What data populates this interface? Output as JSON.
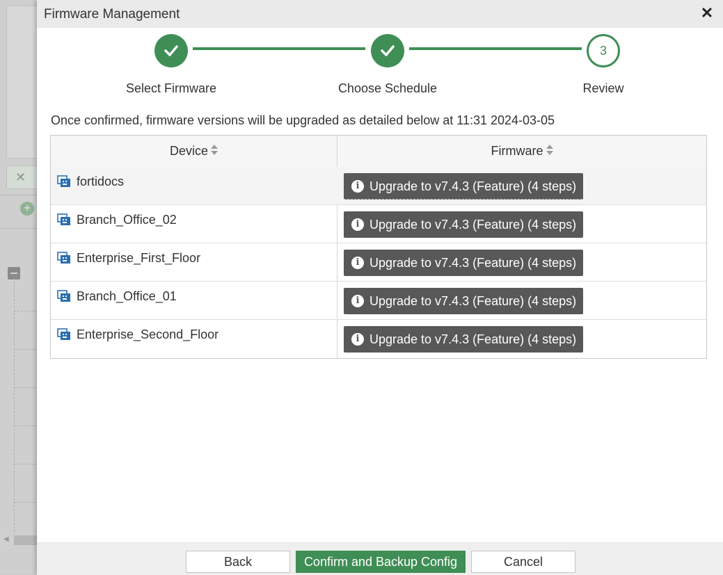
{
  "dialog": {
    "title": "Firmware Management",
    "close_icon": "close-icon"
  },
  "steps": [
    {
      "label": "Select Firmware",
      "state": "done"
    },
    {
      "label": "Choose Schedule",
      "state": "done"
    },
    {
      "label": "Review",
      "state": "current",
      "number": "3"
    }
  ],
  "info_text": "Once confirmed, firmware versions will be upgraded as detailed below at 11:31 2024-03-05",
  "table": {
    "columns": [
      "Device",
      "Firmware"
    ],
    "rows": [
      {
        "device": "fortidocs",
        "firmware": "Upgrade to v7.4.3 (Feature) (4 steps)"
      },
      {
        "device": "Branch_Office_02",
        "firmware": "Upgrade to v7.4.3 (Feature) (4 steps)"
      },
      {
        "device": "Enterprise_First_Floor",
        "firmware": "Upgrade to v7.4.3 (Feature) (4 steps)"
      },
      {
        "device": "Branch_Office_01",
        "firmware": "Upgrade to v7.4.3 (Feature) (4 steps)"
      },
      {
        "device": "Enterprise_Second_Floor",
        "firmware": "Upgrade to v7.4.3 (Feature) (4 steps)"
      }
    ]
  },
  "footer": {
    "back_label": "Back",
    "confirm_label": "Confirm and Backup Config",
    "cancel_label": "Cancel"
  },
  "colors": {
    "accent": "#3f8e55",
    "badge": "#585858"
  }
}
